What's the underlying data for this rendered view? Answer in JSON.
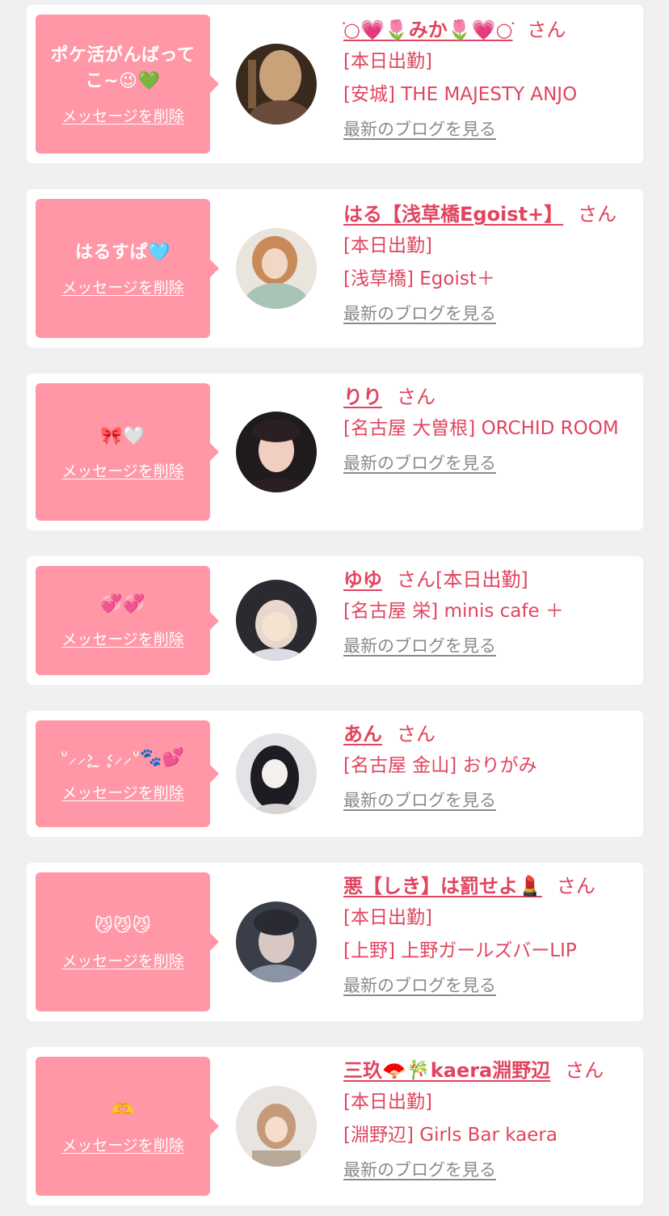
{
  "messages": [
    {
      "bubble_text": "ポケ活がんばってこ~😉💚",
      "delete_label": "メッセージを削除",
      "name": "○ֹ💗🌷みか🌷💗○ֹ",
      "suffix": "さん",
      "status": "[本日出勤]",
      "shop": "[安城] THE MAJESTY ANJO",
      "blog_label": "最新のブログを見る",
      "avatar_colors": [
        "#3a2a1e",
        "#c9a27a",
        "#7a5a3a"
      ]
    },
    {
      "bubble_text": "はるすぱ🩵",
      "delete_label": "メッセージを削除",
      "name": "はる【浅草橋Egoist+】",
      "suffix": "さん",
      "status": "[本日出勤]",
      "shop": "[浅草橋] Egoist＋",
      "blog_label": "最新のブログを見る",
      "avatar_colors": [
        "#e9e4dc",
        "#c98a5a",
        "#a8c4b4"
      ]
    },
    {
      "bubble_text": "🎀🤍",
      "delete_label": "メッセージを削除",
      "name": "りり",
      "suffix": "さん",
      "status": "",
      "shop": "[名古屋 大曽根] ORCHID ROOM",
      "blog_label": "最新のブログを見る",
      "avatar_colors": [
        "#1e1a1e",
        "#f0cfc0",
        "#2a2024"
      ]
    },
    {
      "bubble_text": "💞💞",
      "delete_label": "メッセージを削除",
      "name": "ゆゆ",
      "suffix": "さん",
      "status_inline": "[本日出勤]",
      "status": "",
      "shop": "[名古屋 栄] minis cafe ＋",
      "blog_label": "最新のブログを見る",
      "avatar_colors": [
        "#2a2a30",
        "#e8d8cc",
        "#f3e3d0"
      ]
    },
    {
      "bubble_text": "ᐡ⸝⸝›̥ ̫ ‹̥⸝⸝ᐡ🐾💕",
      "delete_label": "メッセージを削除",
      "name": "あん",
      "suffix": "さん",
      "status": "",
      "shop": "[名古屋 金山] おりがみ",
      "blog_label": "最新のブログを見る",
      "avatar_colors": [
        "#1c1c22",
        "#f4f0ee",
        "#d8d4d4"
      ]
    },
    {
      "bubble_text": "😼😼😼",
      "delete_label": "メッセージを削除",
      "name": "悪【しき】は罰せよ💄",
      "suffix": "さん",
      "status": "[本日出勤]",
      "shop": "[上野] 上野ガールズバーLIP",
      "blog_label": "最新のブログを見る",
      "avatar_colors": [
        "#3a3e48",
        "#d8c8c4",
        "#8a94a4"
      ]
    },
    {
      "bubble_text": "🫶",
      "delete_label": "メッセージを削除",
      "name": "三玖🪭🎋kaera淵野辺",
      "suffix": "さん",
      "status": "[本日出勤]",
      "shop": "[淵野辺] Girls Bar kaera",
      "blog_label": "最新のブログを見る",
      "avatar_colors": [
        "#e8e4e0",
        "#c49a7a",
        "#b8a896"
      ]
    }
  ]
}
